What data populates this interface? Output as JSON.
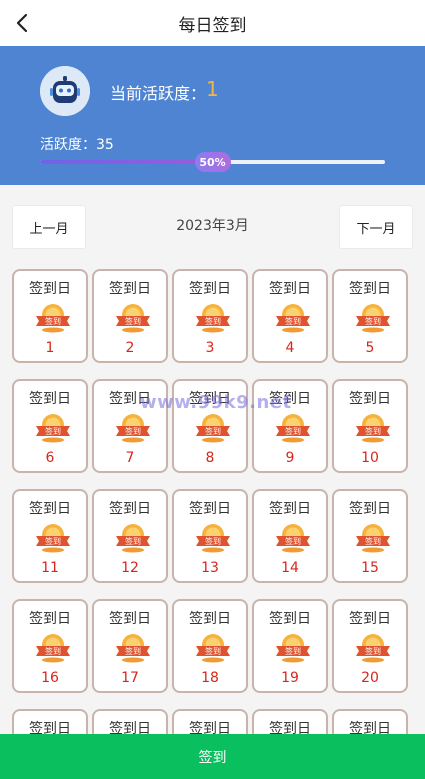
{
  "header": {
    "title": "每日签到",
    "back_icon": "chevron-left-icon"
  },
  "banner": {
    "avatar_icon": "robot-avatar-icon",
    "current_activity_label": "当前活跃度：",
    "current_activity_value": "1",
    "activity_label": "活跃度：35",
    "progress_percent_text": "50%",
    "progress_fraction": 0.5,
    "background_color": "#4f84d2",
    "value_color": "#f0b54b"
  },
  "month_nav": {
    "prev_label": "上一月",
    "current_month": "2023年3月",
    "next_label": "下一月"
  },
  "calendar": {
    "cell_label": "签到日",
    "stamp_text": "签到",
    "stamp_icon": "sign-stamp-icon",
    "days": [
      "1",
      "2",
      "3",
      "4",
      "5",
      "6",
      "7",
      "8",
      "9",
      "10",
      "11",
      "12",
      "13",
      "14",
      "15",
      "16",
      "17",
      "18",
      "19",
      "20",
      "",
      "",
      "",
      "",
      ""
    ]
  },
  "watermark": {
    "text": "www.99k9.net"
  },
  "footer": {
    "sign_button_label": "签到",
    "button_color": "#0ac05e"
  }
}
